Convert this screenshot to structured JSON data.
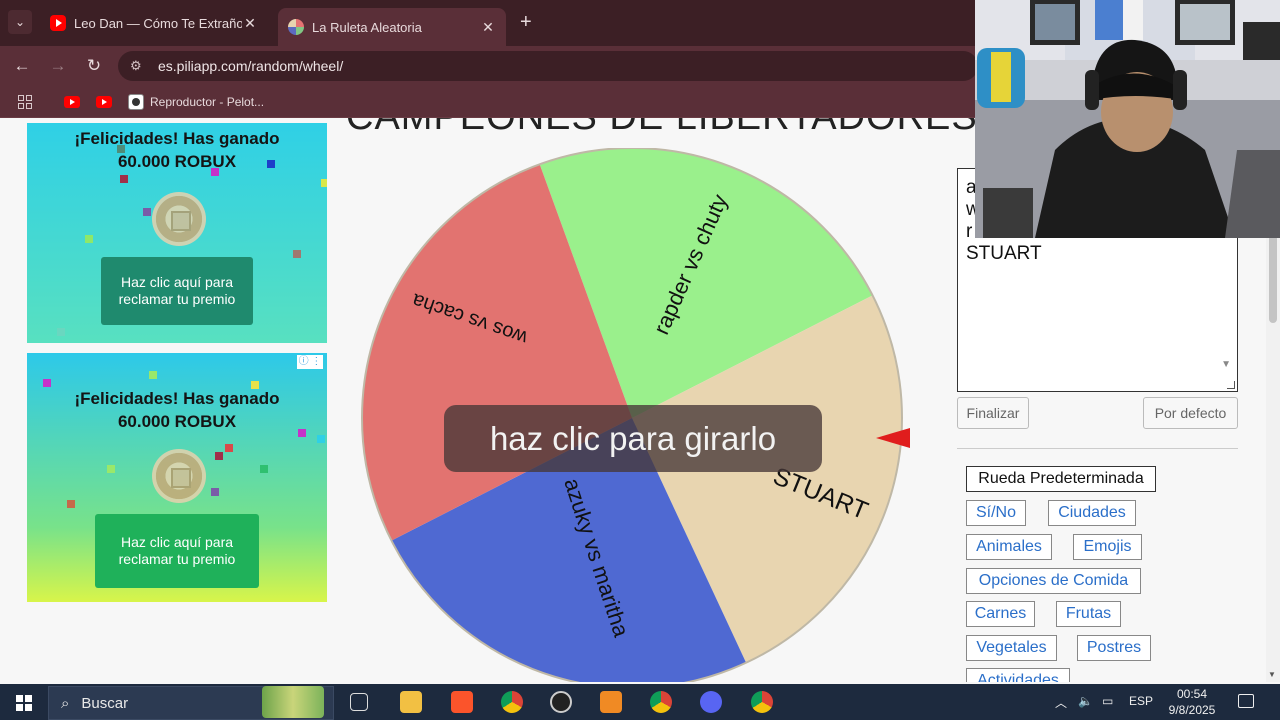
{
  "browser": {
    "tabs": [
      {
        "title": "Leo Dan — Cómo Te Extraño M",
        "icon": "youtube-icon"
      },
      {
        "title": "La Ruleta Aleatoria",
        "icon": "wheel-icon"
      }
    ],
    "url": "es.piliapp.com/random/wheel/",
    "bookmark_label": "Reproductor - Pelot..."
  },
  "ads": [
    {
      "title_line1": "¡Felicidades! Has ganado",
      "title_line2": "60.000 ROBUX",
      "button": "Haz clic aquí para reclamar tu premio"
    },
    {
      "title_line1": "¡Felicidades! Has ganado",
      "title_line2": "60.000 ROBUX",
      "button": "Haz clic aquí para reclamar tu premio",
      "choice_icon": "ⓘ ⋮"
    }
  ],
  "wheel": {
    "title": "CAMPEONES DE LIBERTADORES",
    "spin_label": "haz clic para girarlo",
    "segments": [
      {
        "label": "rapder vs chuty",
        "color": "#9af08c"
      },
      {
        "label": "STUART",
        "color": "#e8d5b0"
      },
      {
        "label": "azuky vs maritha",
        "color": "#4f69d2"
      },
      {
        "label": "wos vs cacha",
        "color": "#e27370"
      }
    ],
    "pointer_color": "#e01d1d"
  },
  "editor": {
    "lines": [
      "a",
      "w",
      "r",
      "STUART"
    ]
  },
  "buttons": {
    "finish": "Finalizar",
    "default": "Por defecto"
  },
  "presets": [
    "Rueda Predeterminada",
    "Sí/No",
    "Ciudades",
    "Animales",
    "Emojis",
    "Opciones de Comida",
    "Carnes",
    "Frutas",
    "Vegetales",
    "Postres",
    "Actividades"
  ],
  "taskbar": {
    "search_placeholder": "Buscar",
    "language": "ESP",
    "time": "00:54",
    "date": "9/8/2025"
  }
}
